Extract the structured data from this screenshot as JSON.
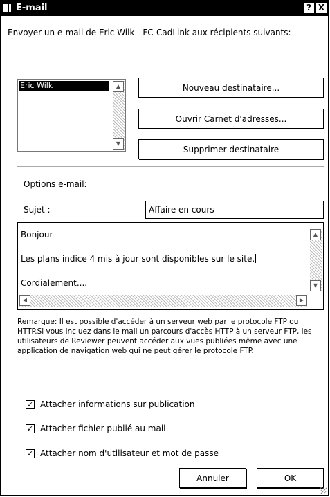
{
  "window": {
    "title": "E-mail",
    "help_button": "?",
    "close_button": "X"
  },
  "header_text": "Envoyer un e-mail de Eric Wilk - FC-CadLink aux récipients suivants:",
  "recipients": {
    "items": [
      "Eric Wilk"
    ],
    "selected_index": 0
  },
  "buttons": {
    "new_recipient": "Nouveau destinataire...",
    "open_address_book": "Ouvrir Carnet d'adresses...",
    "delete_recipient": "Supprimer destinataire",
    "cancel": "Annuler",
    "ok": "OK"
  },
  "options_label": "Options e-mail:",
  "subject": {
    "label": "Sujet :",
    "value": "Affaire en cours"
  },
  "message_lines": [
    "Bonjour",
    "Les plans indice 4 mis à jour sont disponibles sur le site.",
    "Cordialement...."
  ],
  "note": "Remarque: Il est possible d'accéder à un serveur web par le protocole FTP ou HTTP.Si vous incluez dans le mail un parcours d'accès HTTP à un serveur FTP, les utilisateurs de Reviewer peuvent accéder aux vues publiées même avec une application de navigation web qui ne peut gérer le protocole FTP.",
  "checkboxes": [
    {
      "label": "Attacher informations sur publication",
      "checked": true
    },
    {
      "label": "Attacher fichier publié au mail",
      "checked": true
    },
    {
      "label": "Attacher nom d'utilisateur et mot de passe",
      "checked": true
    }
  ],
  "icons": {
    "app_icon": "bars-app-icon",
    "scroll_up": "arrow-up-icon",
    "scroll_down": "arrow-down-icon",
    "scroll_left": "arrow-left-icon",
    "scroll_right": "arrow-right-icon",
    "check": "checkmark-icon"
  }
}
